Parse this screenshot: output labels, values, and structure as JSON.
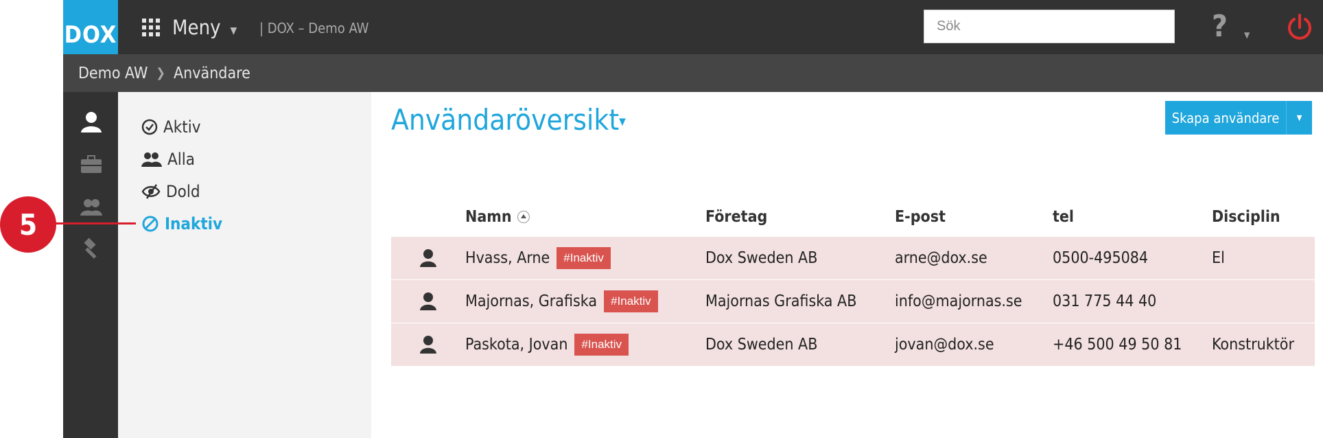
{
  "topbar": {
    "logo_text": "DOX",
    "menu_label": "Meny",
    "app_name": "| DOX – Demo AW",
    "search_placeholder": "Sök",
    "help_label": "?",
    "brand_color": "#1fa6dc",
    "power_color": "#e03030"
  },
  "breadcrumb": {
    "items": [
      "Demo AW",
      "Användare"
    ]
  },
  "rail": {
    "icons": [
      "user-icon",
      "briefcase-icon",
      "users-icon",
      "gavel-icon"
    ]
  },
  "filters": {
    "items": [
      {
        "label": "Aktiv",
        "icon": "check-circle-icon",
        "active": false
      },
      {
        "label": "Alla",
        "icon": "users-icon",
        "active": false
      },
      {
        "label": "Dold",
        "icon": "eye-slash-icon",
        "active": false
      },
      {
        "label": "Inaktiv",
        "icon": "ban-icon",
        "active": true
      }
    ]
  },
  "callout": {
    "number": "5"
  },
  "main": {
    "title": "Användaröversikt",
    "create_button_label": "Skapa användare"
  },
  "table": {
    "columns": [
      "Namn",
      "Företag",
      "E-post",
      "tel",
      "Disciplin"
    ],
    "rows": [
      {
        "name": "Hvass, Arne",
        "badge": "#Inaktiv",
        "company": "Dox Sweden AB",
        "email": "arne@dox.se",
        "tel": "0500-495084",
        "discipline": "El"
      },
      {
        "name": "Majornas, Grafiska",
        "badge": "#Inaktiv",
        "company": "Majornas Grafiska AB",
        "email": "info@majornas.se",
        "tel": "031 775 44 40",
        "discipline": ""
      },
      {
        "name": "Paskota, Jovan",
        "badge": "#Inaktiv",
        "company": "Dox Sweden AB",
        "email": "jovan@dox.se",
        "tel": "+46 500 49 50 81",
        "discipline": "Konstruktör"
      }
    ],
    "row_color": "#f3e0e0",
    "badge_color": "#d9534f"
  }
}
